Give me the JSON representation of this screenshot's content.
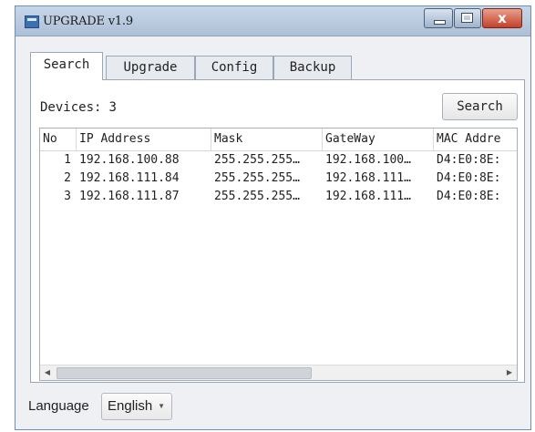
{
  "window": {
    "title": "UPGRADE v1.9"
  },
  "window_controls": {
    "close_glyph": "x"
  },
  "tabs": [
    {
      "label": "Search",
      "active": true
    },
    {
      "label": "Upgrade",
      "active": false
    },
    {
      "label": "Config",
      "active": false
    },
    {
      "label": "Backup",
      "active": false
    }
  ],
  "search_tab": {
    "devices_label": "Devices:",
    "devices_count": "3",
    "search_button": "Search",
    "columns": [
      "No",
      "IP Address",
      "Mask",
      "GateWay",
      "MAC Addre"
    ],
    "rows": [
      {
        "no": "1",
        "ip": "192.168.100.88",
        "mask": "255.255.255…",
        "gateway": "192.168.100…",
        "mac": "D4:E0:8E:"
      },
      {
        "no": "2",
        "ip": "192.168.111.84",
        "mask": "255.255.255…",
        "gateway": "192.168.111…",
        "mac": "D4:E0:8E:"
      },
      {
        "no": "3",
        "ip": "192.168.111.87",
        "mask": "255.255.255…",
        "gateway": "192.168.111…",
        "mac": "D4:E0:8E:"
      }
    ]
  },
  "footer": {
    "language_label": "Language",
    "language_value": "English"
  },
  "icons": {
    "app": "app-icon",
    "minimize": "minimize-icon",
    "maximize": "maximize-icon",
    "close": "close-icon",
    "dropdown": "chevron-down-icon",
    "scroll_left": "arrow-left-icon",
    "scroll_right": "arrow-right-icon"
  }
}
